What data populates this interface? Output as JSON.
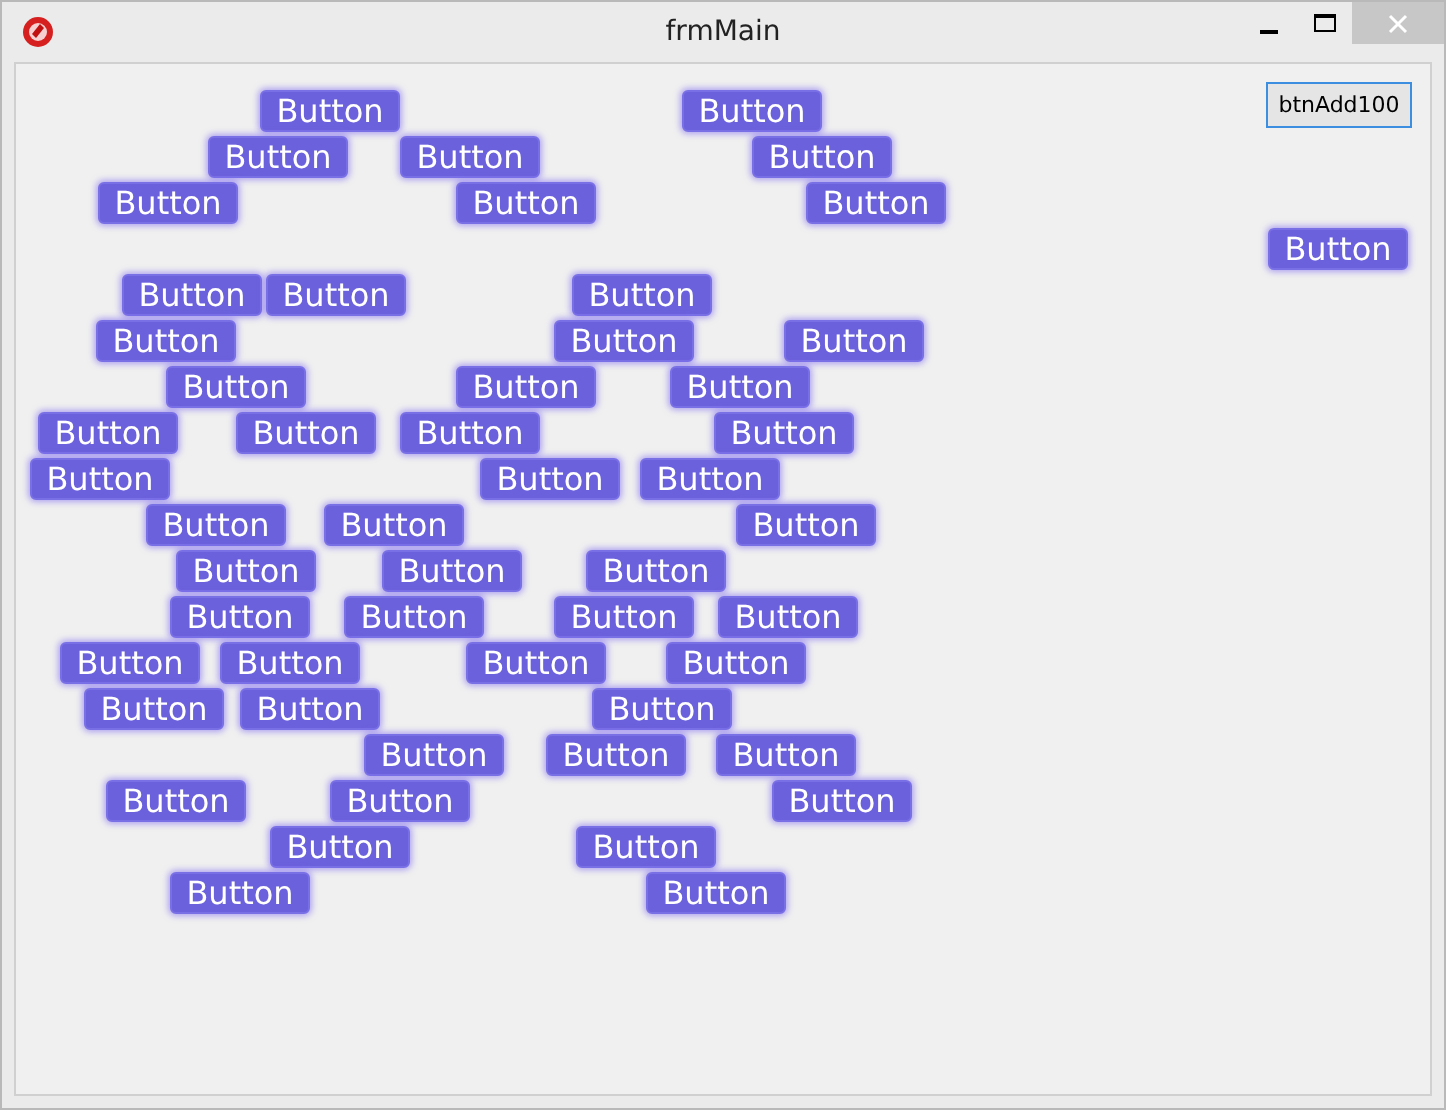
{
  "window": {
    "title": "frmMain"
  },
  "add_button": {
    "label": "btnAdd100"
  },
  "buttons": [
    "Button",
    "Button",
    "Button",
    "Button",
    "Button",
    "Button",
    "Button",
    "Button",
    "Button",
    "Button",
    "Button",
    "Button",
    "Button",
    "Button",
    "Button",
    "Button",
    "Button",
    "Button",
    "Button",
    "Button",
    "Button",
    "Button",
    "Button",
    "Button",
    "Button",
    "Button",
    "Button",
    "Button",
    "Button",
    "Button",
    "Button",
    "Button",
    "Button",
    "Button",
    "Button",
    "Button",
    "Button",
    "Button",
    "Button",
    "Button",
    "Button",
    "Button",
    "Button",
    "Button",
    "Button",
    "Button",
    "Button",
    "Button",
    "Button",
    "Button",
    "Button",
    "Button"
  ]
}
